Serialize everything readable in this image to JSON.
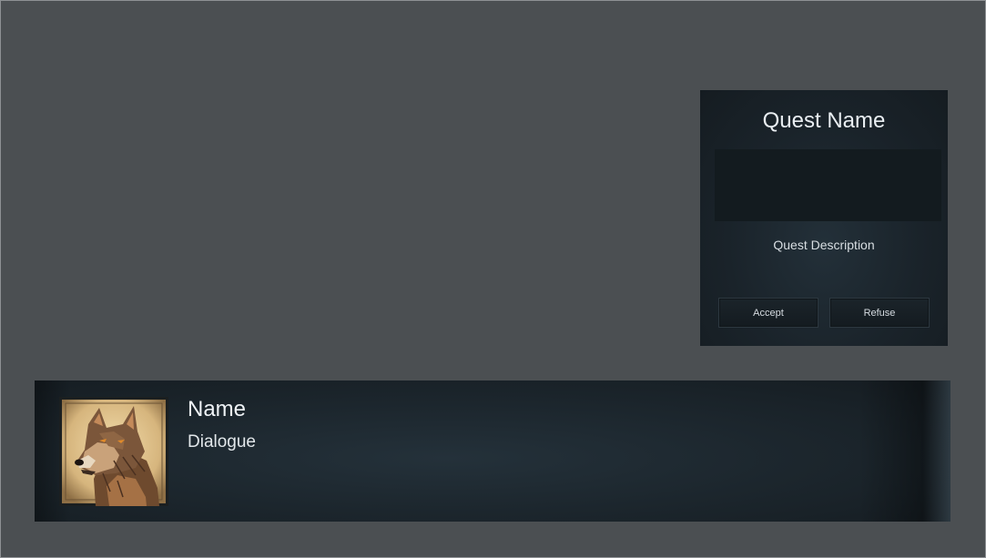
{
  "quest": {
    "title": "Quest Name",
    "description": "Quest Description",
    "accept_label": "Accept",
    "refuse_label": "Refuse"
  },
  "dialogue": {
    "speaker_name": "Name",
    "text": "Dialogue",
    "portrait_icon": "wolf-portrait-icon"
  },
  "colors": {
    "background": "#4b4f52",
    "panel": "#1a232a",
    "text": "#e9eef2"
  }
}
